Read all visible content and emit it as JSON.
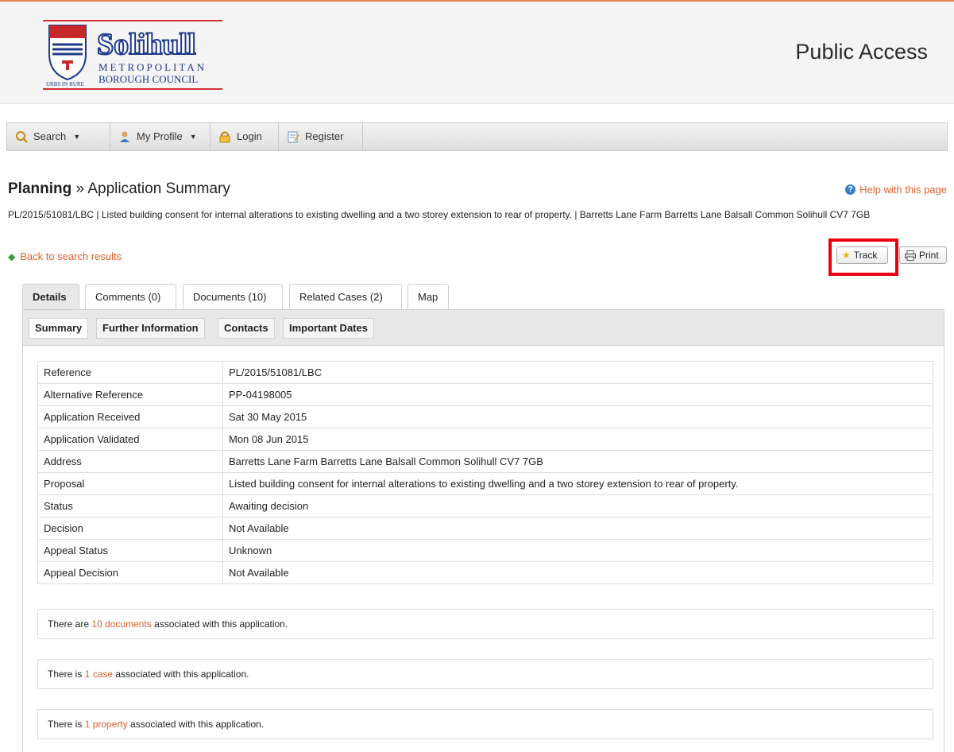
{
  "header": {
    "logo": {
      "name": "Solihull",
      "line1": "METROPOLITAN",
      "line2": "BOROUGH COUNCIL",
      "motto": "URBS IN RURE"
    },
    "site_title": "Public Access"
  },
  "nav": {
    "items": [
      {
        "label": "Search",
        "icon": "search-icon",
        "dropdown": true
      },
      {
        "label": "My Profile",
        "icon": "user-icon",
        "dropdown": true
      },
      {
        "label": "Login",
        "icon": "lock-icon",
        "dropdown": false
      },
      {
        "label": "Register",
        "icon": "register-icon",
        "dropdown": false
      }
    ]
  },
  "page": {
    "title_section": "Planning",
    "title_separator": "»",
    "title_page": "Application Summary",
    "help_label": "Help with this page",
    "description": "PL/2015/51081/LBC | Listed building consent for internal alterations to existing dwelling and a two storey extension to rear of property. | Barretts Lane Farm Barretts Lane Balsall Common Solihull CV7 7GB",
    "back_label": "Back to search results"
  },
  "actions": {
    "track_label": "Track",
    "print_label": "Print"
  },
  "tabs": [
    {
      "label": "Details",
      "active": true
    },
    {
      "label": "Comments (0)",
      "active": false
    },
    {
      "label": "Documents (10)",
      "active": false
    },
    {
      "label": "Related Cases (2)",
      "active": false
    },
    {
      "label": "Map",
      "active": false
    }
  ],
  "subtabs": [
    {
      "label": "Summary",
      "active": true
    },
    {
      "label": "Further Information",
      "active": false
    },
    {
      "label": "Contacts",
      "active": false
    },
    {
      "label": "Important Dates",
      "active": false
    }
  ],
  "summary_rows": [
    {
      "label": "Reference",
      "value": "PL/2015/51081/LBC"
    },
    {
      "label": "Alternative Reference",
      "value": "PP-04198005"
    },
    {
      "label": "Application Received",
      "value": "Sat 30 May 2015"
    },
    {
      "label": "Application Validated",
      "value": "Mon 08 Jun 2015"
    },
    {
      "label": "Address",
      "value": "Barretts Lane Farm Barretts Lane Balsall Common Solihull CV7 7GB"
    },
    {
      "label": "Proposal",
      "value": "Listed building consent for internal alterations to existing dwelling and a two storey extension to rear of property."
    },
    {
      "label": "Status",
      "value": "Awaiting decision"
    },
    {
      "label": "Decision",
      "value": "Not Available"
    },
    {
      "label": "Appeal Status",
      "value": "Unknown"
    },
    {
      "label": "Appeal Decision",
      "value": "Not Available"
    }
  ],
  "info": {
    "documents": {
      "pre": "There are ",
      "link": "10 documents",
      "post": " associated with this application."
    },
    "cases": {
      "pre": "There is ",
      "link": "1 case",
      "post": " associated with this application."
    },
    "properties": {
      "pre": "There is ",
      "link": "1 property",
      "post": " associated with this application."
    }
  },
  "colors": {
    "accent_link": "#e0602b",
    "highlight": "#e8000e",
    "logo_blue": "#1f3a8a",
    "logo_red": "#d32f2f"
  }
}
